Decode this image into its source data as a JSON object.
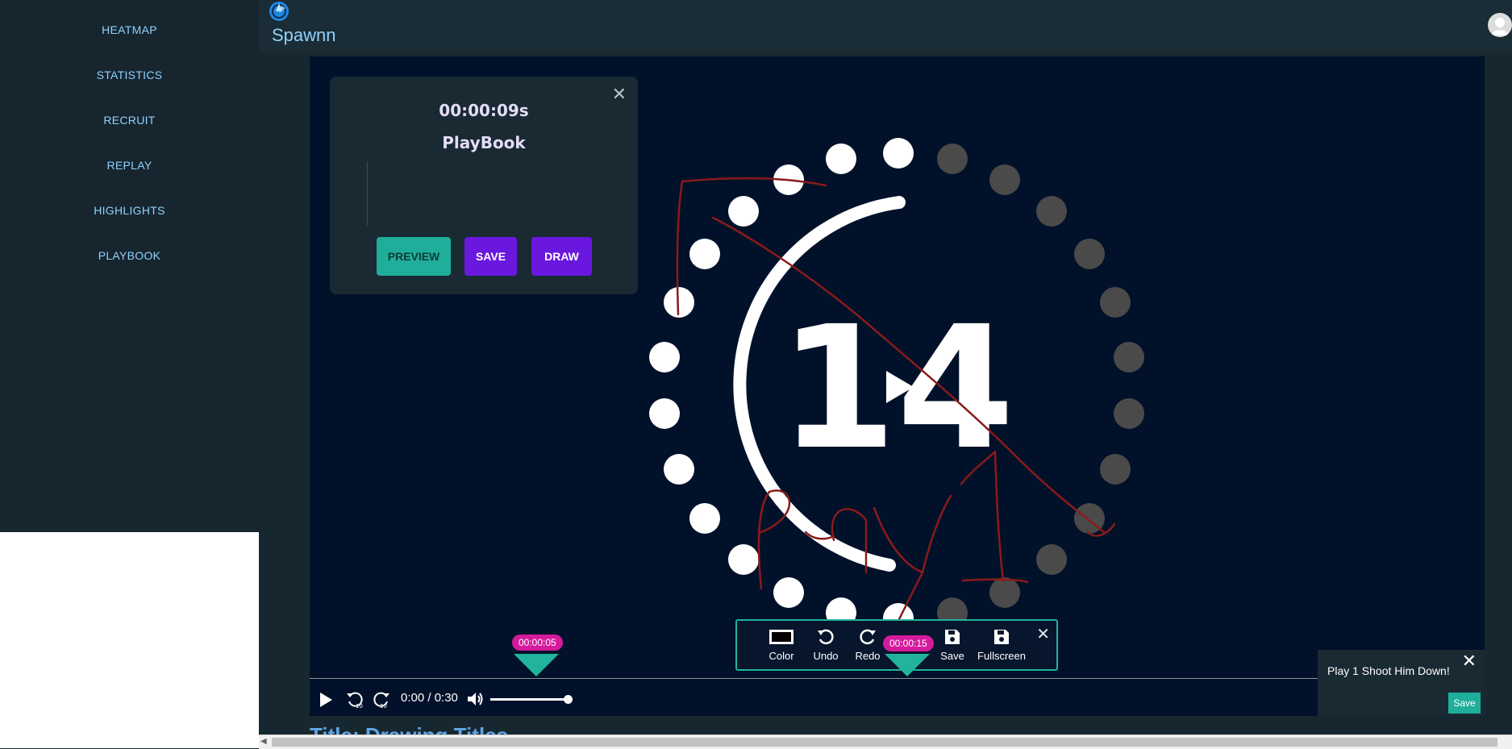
{
  "sidebar": {
    "items": [
      {
        "label": "HEATMAP"
      },
      {
        "label": "STATISTICS"
      },
      {
        "label": "RECRUIT"
      },
      {
        "label": "REPLAY"
      },
      {
        "label": "HIGHLIGHTS"
      },
      {
        "label": "PLAYBOOK"
      }
    ]
  },
  "header": {
    "title": "Spawnn",
    "logo_icon": "aperture-icon",
    "avatar_icon": "user-avatar-icon"
  },
  "video": {
    "countdown_number": "14",
    "play_overlay_icon": "play-icon",
    "drawing_text": "Play 1"
  },
  "playbook_panel": {
    "timestamp": "00:00:09s",
    "title": "PlayBook",
    "close_icon": "close-icon",
    "buttons": {
      "preview": "PREVIEW",
      "save": "SAVE",
      "draw": "DRAW"
    }
  },
  "drawing_toolbar": {
    "tools": [
      {
        "label": "Color",
        "icon": "color-swatch-icon"
      },
      {
        "label": "Undo",
        "icon": "undo-icon"
      },
      {
        "label": "Redo",
        "icon": "redo-icon"
      },
      {
        "label": "Save",
        "icon": "save-icon"
      },
      {
        "label": "Fullscreen",
        "icon": "save-icon"
      }
    ],
    "close_icon": "close-icon"
  },
  "markers": [
    {
      "time": "00:00:05"
    },
    {
      "time": "00:00:15"
    }
  ],
  "player": {
    "time_display": "0:00 / 0:30",
    "play_icon": "play-icon",
    "rewind_icon": "rewind-10-icon",
    "forward_icon": "forward-10-icon",
    "volume_icon": "volume-icon",
    "volume_level": 0.85
  },
  "comment_panel": {
    "text": "Play 1 Shoot Him Down!",
    "save_label": "Save",
    "close_icon": "close-icon"
  },
  "below_video": {
    "title": "Title: Drawing Titles"
  },
  "colors": {
    "accent_teal": "#1fae9a",
    "accent_purple": "#6a17e0",
    "marker_pink": "#d51b9c",
    "drawing_red": "#8b1a1a",
    "nav_text": "#8fd3ff"
  }
}
